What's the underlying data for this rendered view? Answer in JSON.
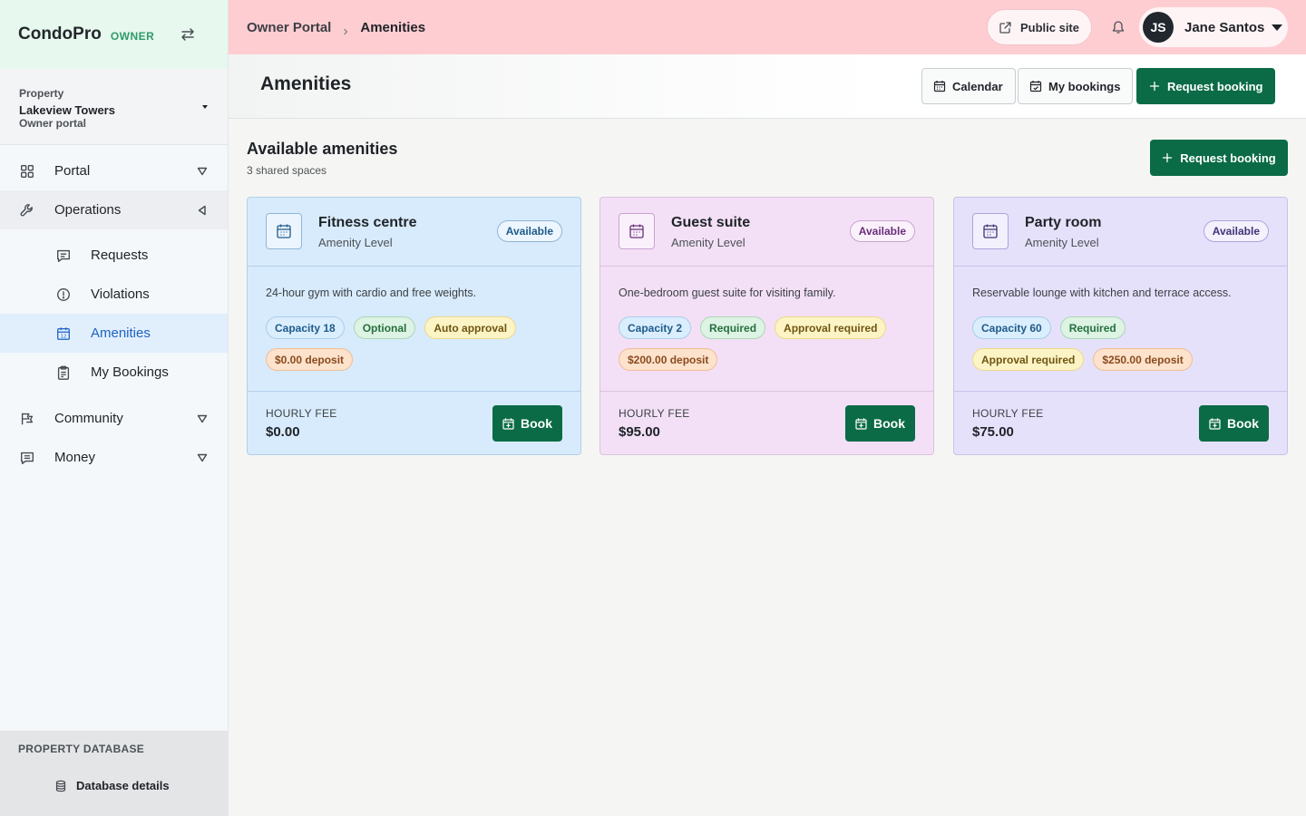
{
  "sidebar": {
    "brand": "CondoPro",
    "role": "OWNER",
    "property": {
      "label": "Property",
      "name": "Lakeview Towers",
      "sub": "Owner portal"
    },
    "nav": [
      {
        "label": "Portal",
        "icon": "grid-icon"
      },
      {
        "label": "Operations",
        "icon": "wrench-icon"
      },
      {
        "label": "Community",
        "icon": "flag-icon"
      },
      {
        "label": "Money",
        "icon": "receipt-icon"
      }
    ],
    "operations_items": [
      {
        "label": "Requests",
        "icon": "message-icon"
      },
      {
        "label": "Violations",
        "icon": "alert-circle-icon"
      },
      {
        "label": "Amenities",
        "icon": "calendar-icon"
      },
      {
        "label": "My Bookings",
        "icon": "clipboard-icon"
      }
    ],
    "db_title": "PROPERTY DATABASE",
    "db_item": "Database details"
  },
  "topbar": {
    "crumb_root": "Owner Portal",
    "crumb_current": "Amenities",
    "public_site": "Public site",
    "user": {
      "initials": "JS",
      "name": "Jane Santos"
    }
  },
  "header": {
    "title": "Amenities",
    "calendar": "Calendar",
    "my_bookings": "My bookings",
    "request_booking": "Request booking"
  },
  "section": {
    "title": "Available amenities",
    "subtitle": "3 shared spaces",
    "request_booking": "Request booking"
  },
  "amenities": [
    {
      "name": "Fitness centre",
      "level": "Amenity Level",
      "status": "Available",
      "description": "24-hour gym with cardio and free weights.",
      "capacity": "Capacity 18",
      "requirement": "Optional",
      "approval": "Auto approval",
      "deposit": "$0.00 deposit",
      "fee_label": "HOURLY FEE",
      "fee": "$0.00",
      "book": "Book"
    },
    {
      "name": "Guest suite",
      "level": "Amenity Level",
      "status": "Available",
      "description": "One-bedroom guest suite for visiting family.",
      "capacity": "Capacity 2",
      "requirement": "Required",
      "approval": "Approval required",
      "deposit": "$200.00 deposit",
      "fee_label": "HOURLY FEE",
      "fee": "$95.00",
      "book": "Book"
    },
    {
      "name": "Party room",
      "level": "Amenity Level",
      "status": "Available",
      "description": "Reservable lounge with kitchen and terrace access.",
      "capacity": "Capacity 60",
      "requirement": "Required",
      "approval": "Approval required",
      "deposit": "$250.00 deposit",
      "fee_label": "HOURLY FEE",
      "fee": "$75.00",
      "book": "Book"
    }
  ],
  "colors": {
    "primary": "#0b6b47",
    "topbar": "#fecdd2",
    "active_nav": "#e1eefc",
    "card_blue": "#d8ebfc",
    "card_pink": "#f3e0f6",
    "card_lavender": "#e6e1fb"
  }
}
